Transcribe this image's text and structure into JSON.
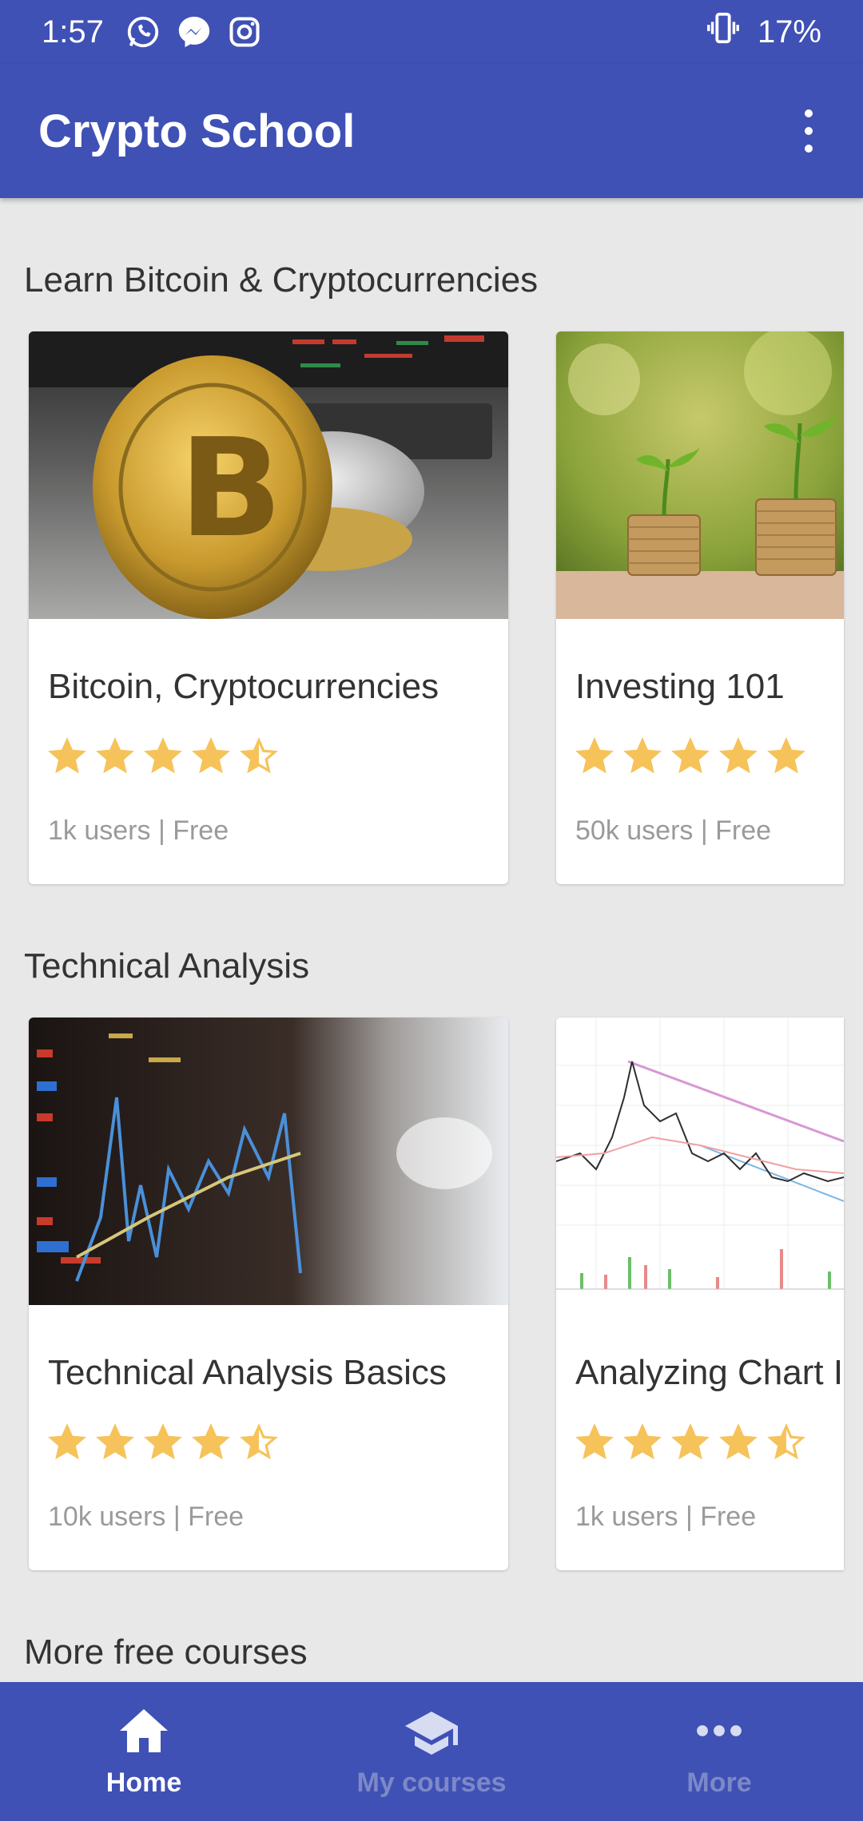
{
  "status": {
    "time": "1:57",
    "battery": "17%"
  },
  "appbar": {
    "title": "Crypto School"
  },
  "sections": [
    {
      "title": "Learn Bitcoin & Cryptocurrencies",
      "cards": [
        {
          "title": "Bitcoin, Cryptocurrencies",
          "rating": 4.5,
          "meta": "1k users | Free"
        },
        {
          "title": "Investing 101",
          "rating": 5,
          "meta": "50k users | Free"
        }
      ]
    },
    {
      "title": "Technical Analysis",
      "cards": [
        {
          "title": "Technical Analysis Basics",
          "rating": 4.5,
          "meta": "10k users | Free"
        },
        {
          "title": "Analyzing Chart I",
          "rating": 4.5,
          "meta": "1k users | Free"
        }
      ]
    },
    {
      "title": "More free courses"
    }
  ],
  "nav": [
    {
      "label": "Home",
      "icon": "home-icon",
      "active": true
    },
    {
      "label": "My courses",
      "icon": "graduation-cap-icon",
      "active": false
    },
    {
      "label": "More",
      "icon": "more-horiz-icon",
      "active": false
    }
  ],
  "colors": {
    "primary": "#3f51b5",
    "star": "#f6c35a",
    "background": "#e8e8e8"
  }
}
